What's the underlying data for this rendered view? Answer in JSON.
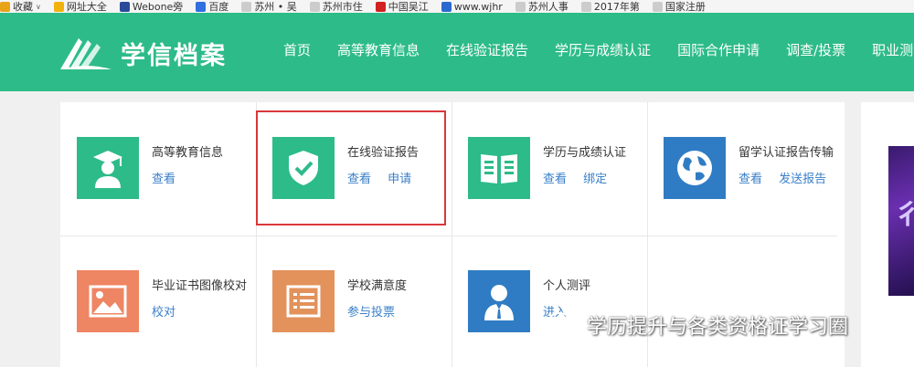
{
  "bookmarks": [
    {
      "label": "收藏",
      "color": "#e8a317",
      "chevron": true
    },
    {
      "label": "网址大全",
      "color": "#f2b20c"
    },
    {
      "label": "Webone旁",
      "color": "#2a4a9a"
    },
    {
      "label": "百度",
      "color": "#2f6fe0"
    },
    {
      "label": "苏州 • 吴",
      "color": "#cccccc"
    },
    {
      "label": "苏州市住",
      "color": "#cccccc"
    },
    {
      "label": "中国吴江",
      "color": "#d32020"
    },
    {
      "label": "www.wjhr",
      "color": "#2a6ad0"
    },
    {
      "label": "苏州人事",
      "color": "#cccccc"
    },
    {
      "label": "2017年第",
      "color": "#cccccc"
    },
    {
      "label": "国家注册",
      "color": "#cccccc"
    }
  ],
  "header": {
    "logo_text": "学信档案",
    "bg_color": "#2dbb8a",
    "nav": [
      "首页",
      "高等教育信息",
      "在线验证报告",
      "学历与成绩认证",
      "国际合作申请",
      "调查/投票",
      "职业测评"
    ]
  },
  "tiles": [
    {
      "title": "高等教育信息",
      "links": [
        "查看"
      ],
      "icon": "graduate-icon",
      "color": "#2dbb8a"
    },
    {
      "title": "在线验证报告",
      "links": [
        "查看",
        "申请"
      ],
      "icon": "shield-check-icon",
      "color": "#2dbb8a"
    },
    {
      "title": "学历与成绩认证",
      "links": [
        "查看",
        "绑定"
      ],
      "icon": "book-icon",
      "color": "#2dbb8a"
    },
    {
      "title": "留学认证报告传输",
      "links": [
        "查看",
        "发送报告"
      ],
      "icon": "globe-icon",
      "color": "#2f7cc4"
    },
    {
      "title": "毕业证书图像校对",
      "links": [
        "校对"
      ],
      "icon": "image-icon",
      "color": "#ee8563"
    },
    {
      "title": "学校满意度",
      "links": [
        "参与投票"
      ],
      "icon": "list-icon",
      "color": "#e3925b"
    },
    {
      "title": "个人测评",
      "links": [
        "进入"
      ],
      "icon": "person-icon",
      "color": "#2f7cc4"
    }
  ],
  "watermark": {
    "text": "学历提升与各类资格证学习圈"
  },
  "banner": {
    "glyph": "彳"
  }
}
